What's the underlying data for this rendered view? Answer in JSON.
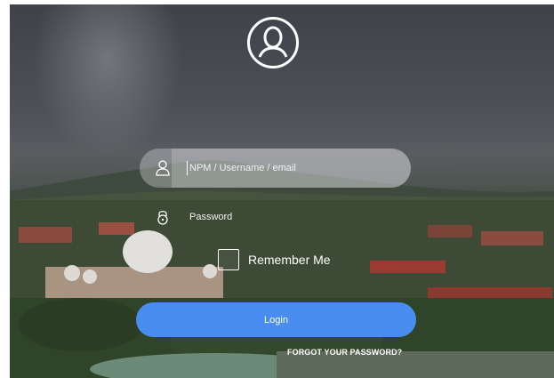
{
  "login": {
    "username_placeholder": "NPM / Username / email",
    "password_placeholder": "Password",
    "remember_label": "Remember Me",
    "login_label": "Login",
    "forgot_label": "FORGOT YOUR PASSWORD?"
  },
  "icons": {
    "avatar": "user-avatar-icon",
    "username": "user-icon",
    "password": "lock-icon"
  },
  "colors": {
    "login_button": "#4a8df0",
    "text": "#ffffff"
  }
}
